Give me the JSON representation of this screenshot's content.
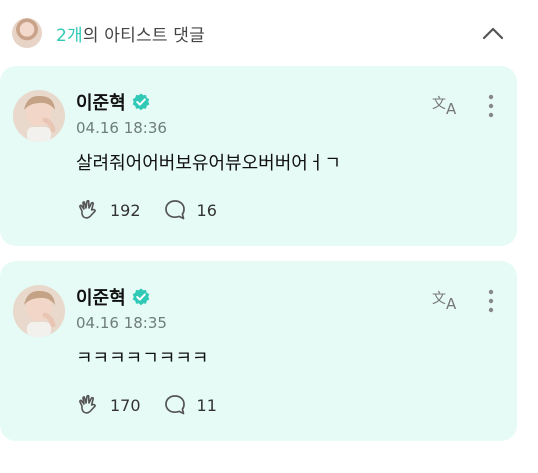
{
  "header": {
    "count": "2개",
    "title_rest": "의 아티스트 댓글"
  },
  "comments": [
    {
      "name": "이준혁",
      "time": "04.16 18:36",
      "text": "살려줘어어버보유어뷰오버버어ㅓㄱ",
      "likes": "192",
      "replies": "16"
    },
    {
      "name": "이준혁",
      "time": "04.16 18:35",
      "text": "ㅋㅋㅋㅋㄱㅋㅋㅋ",
      "likes": "170",
      "replies": "11"
    }
  ],
  "colors": {
    "accent": "#2fc9b6",
    "card_bg": "#e6fbf5",
    "verified": "#2fc9b6"
  },
  "icons": {
    "collapse": "chevron-up-icon",
    "translate": "translate-icon",
    "more": "more-vertical-icon",
    "like": "cheer-hands-icon",
    "reply": "speech-bubble-icon",
    "verified": "verified-badge-icon"
  }
}
